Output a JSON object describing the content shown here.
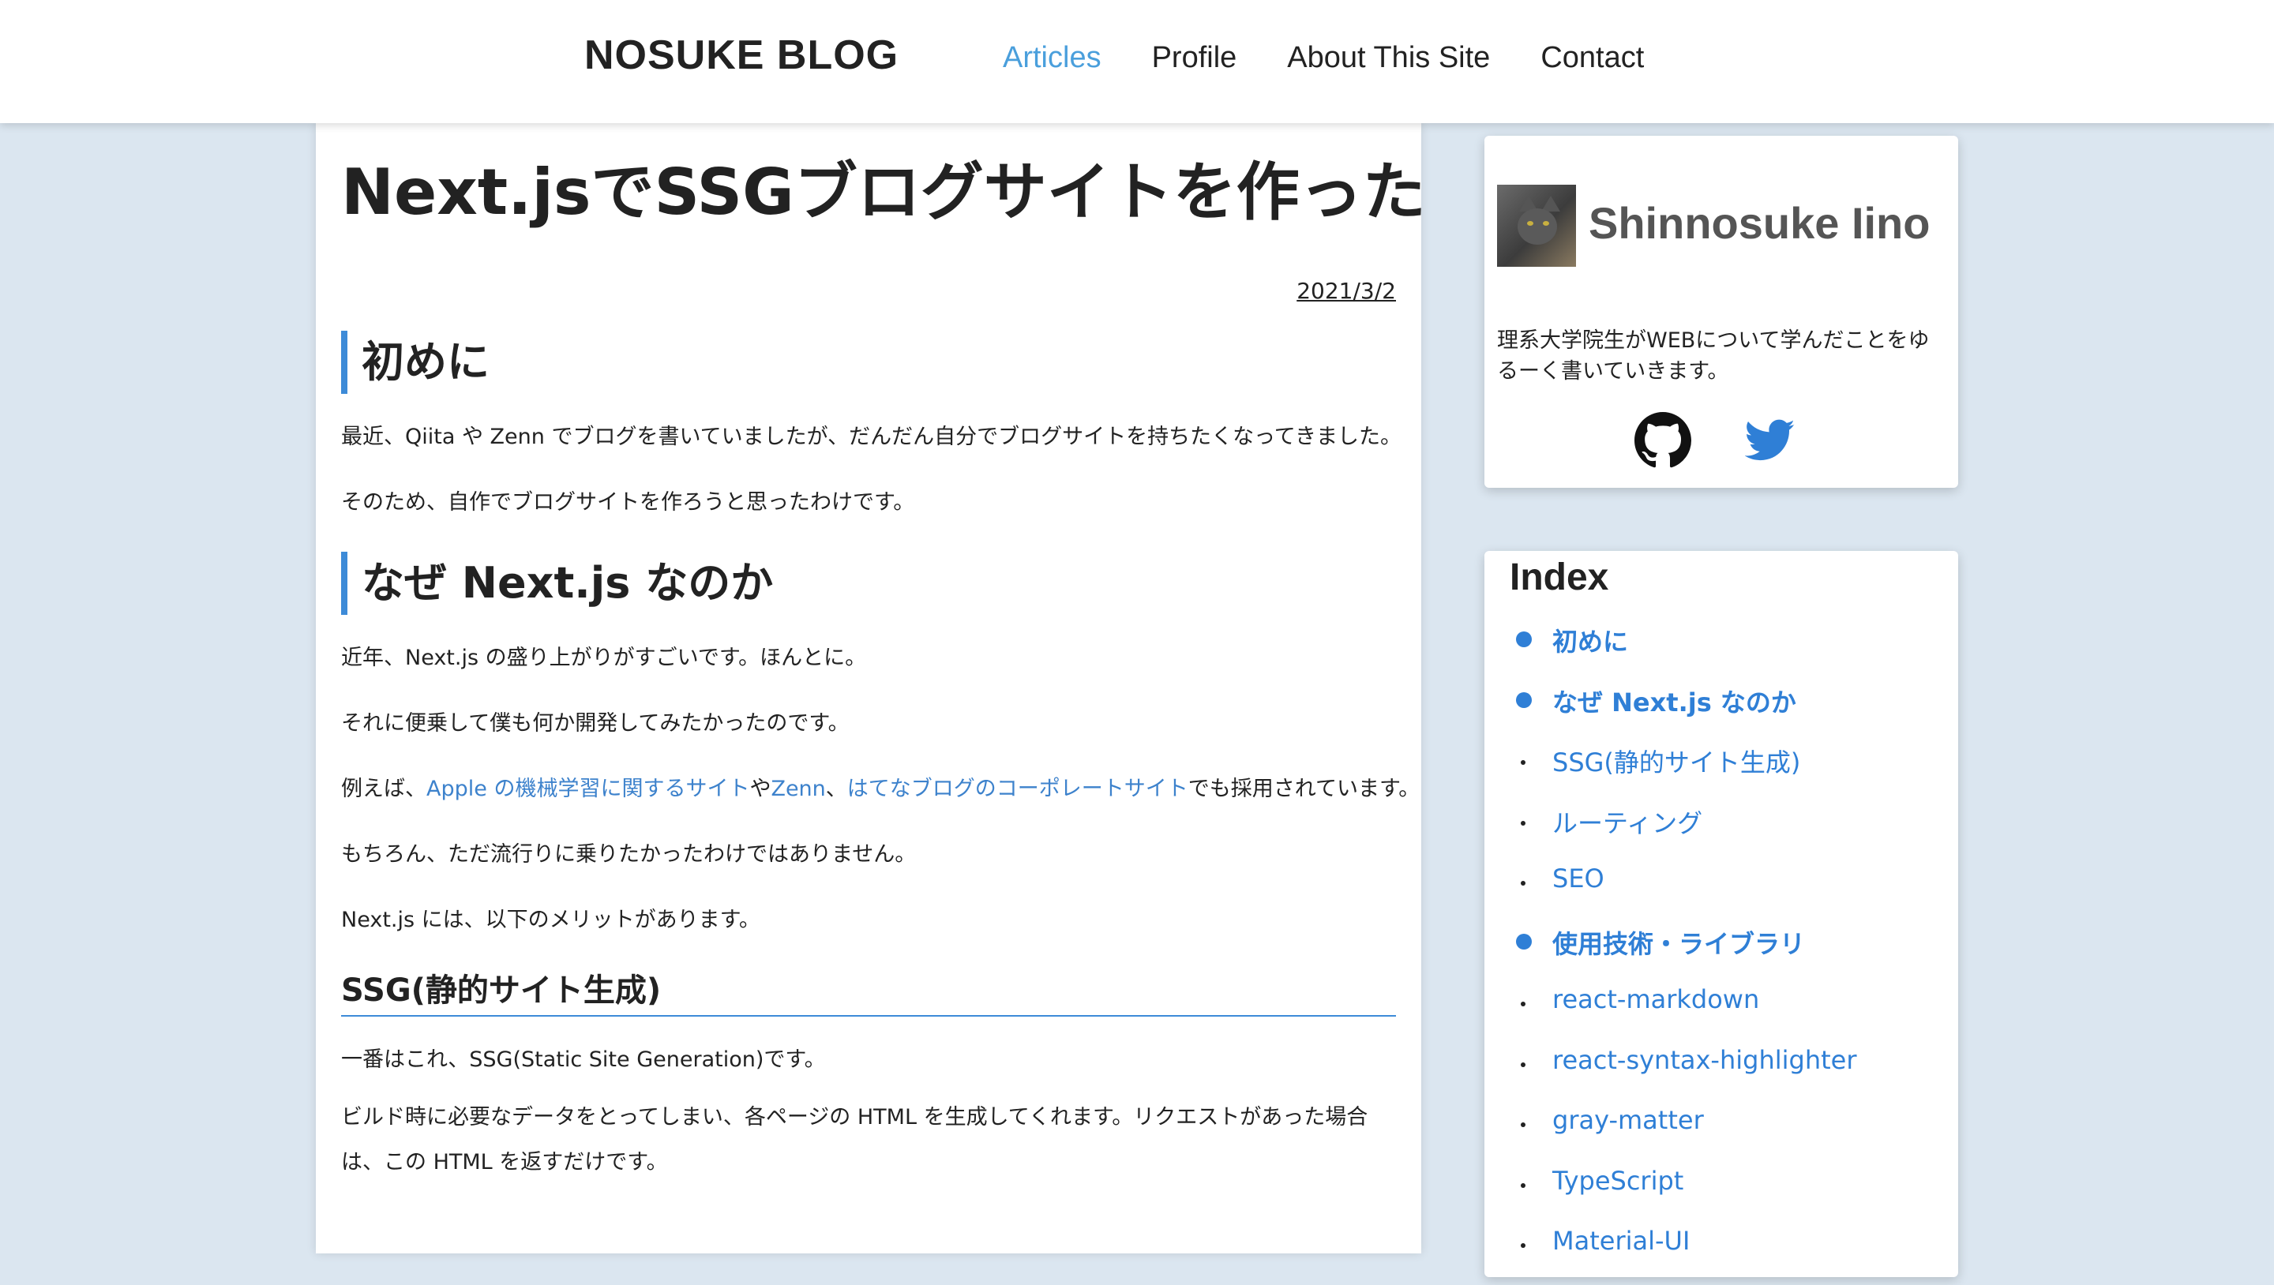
{
  "header": {
    "logo": "NOSUKE BLOG",
    "nav": [
      "Articles",
      "Profile",
      "About This Site",
      "Contact"
    ],
    "active_nav": "Articles"
  },
  "article": {
    "title": "Next.jsでSSGブログサイトを作った話",
    "date": "2021/3/2",
    "sections": [
      {
        "heading": "初めに",
        "paragraphs": [
          "最近、Qiita や Zenn でブログを書いていましたが、だんだん自分でブログサイトを持ちたくなってきました。",
          "そのため、自作でブログサイトを作ろうと思ったわけです。"
        ]
      },
      {
        "heading": "なぜ Next.js なのか",
        "p1": "近年、Next.js の盛り上がりがすごいです。ほんとに。",
        "p2": "それに便乗して僕も何か開発してみたかったのです。",
        "p3": {
          "prefix": "例えば、",
          "link1": "Apple の機械学習に関するサイト",
          "mid1": "や",
          "link2": "Zenn",
          "mid2": "、",
          "link3": "はてなブログのコーポレートサイト",
          "suffix": "でも採用されています。"
        },
        "p4": "もちろん、ただ流行りに乗りたかったわけではありません。",
        "p5": "Next.js には、以下のメリットがあります。"
      }
    ],
    "subsection": {
      "heading": "SSG(静的サイト生成)",
      "p1": "一番はこれ、SSG(Static Site Generation)です。",
      "p2": "ビルド時に必要なデータをとってしまい、各ページの HTML を生成してくれます。リクエストがあった場合は、この HTML を返すだけです。"
    }
  },
  "profile": {
    "name": "Shinnosuke Iino",
    "bio": "理系大学院生がWEBについて学んだことをゆるーく書いていきます。",
    "icons": [
      "github-icon",
      "twitter-icon"
    ],
    "twitter_color": "#2f7fd6"
  },
  "index": {
    "title": "Index",
    "items": [
      {
        "label": "初めに",
        "level": "main"
      },
      {
        "label": "なぜ Next.js なのか",
        "level": "main"
      },
      {
        "label": "SSG(静的サイト生成)",
        "level": "sub"
      },
      {
        "label": "ルーティング",
        "level": "sub"
      },
      {
        "label": "SEO",
        "level": "sub"
      },
      {
        "label": "使用技術・ライブラリ",
        "level": "main"
      },
      {
        "label": "react-markdown",
        "level": "sub"
      },
      {
        "label": "react-syntax-highlighter",
        "level": "sub"
      },
      {
        "label": "gray-matter",
        "level": "sub"
      },
      {
        "label": "TypeScript",
        "level": "sub"
      },
      {
        "label": "Material-UI",
        "level": "sub"
      }
    ]
  },
  "colors": {
    "accent": "#3d8bd8",
    "link": "#3d82cc",
    "nav_active": "#4a9fdc",
    "background": "#dbe6f0"
  }
}
